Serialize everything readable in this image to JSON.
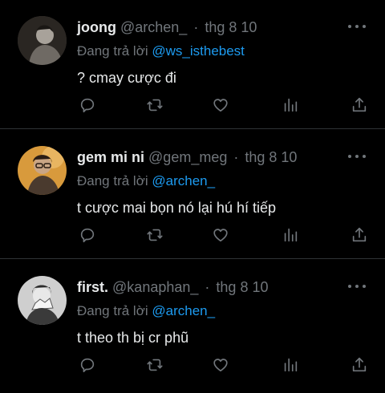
{
  "tweets": [
    {
      "name": "joong",
      "handle": "@archen_",
      "separator": "·",
      "time": "thg 8 10",
      "reply_prefix": "Đang trả lời",
      "reply_to": "@ws_isthebest",
      "text": "? cmay cược đi",
      "avatar_colors": {
        "bg": "#3a3530",
        "fg": "#a8a29a"
      }
    },
    {
      "name": "gem mi ni",
      "handle": "@gem_meg",
      "separator": "·",
      "time": "thg 8 10",
      "reply_prefix": "Đang trả lời",
      "reply_to": "@archen_",
      "text": "t cược mai bọn nó lại hú hí tiếp",
      "avatar_colors": {
        "bg": "#d89a3c",
        "fg": "#2a1d14"
      }
    },
    {
      "name": "first.",
      "handle": "@kanaphan_",
      "separator": "·",
      "time": "thg 8 10",
      "reply_prefix": "Đang trả lời",
      "reply_to": "@archen_",
      "text": "t theo th bị cr phũ",
      "avatar_colors": {
        "bg": "#cfcfcf",
        "fg": "#2b2b2b"
      }
    }
  ],
  "icons": [
    "reply-icon",
    "retweet-icon",
    "like-icon",
    "views-icon",
    "share-icon",
    "more-icon"
  ],
  "colors": {
    "background": "#000000",
    "text": "#e7e9ea",
    "muted": "#71767b",
    "link": "#1d9bf0",
    "divider": "#2f3336"
  }
}
